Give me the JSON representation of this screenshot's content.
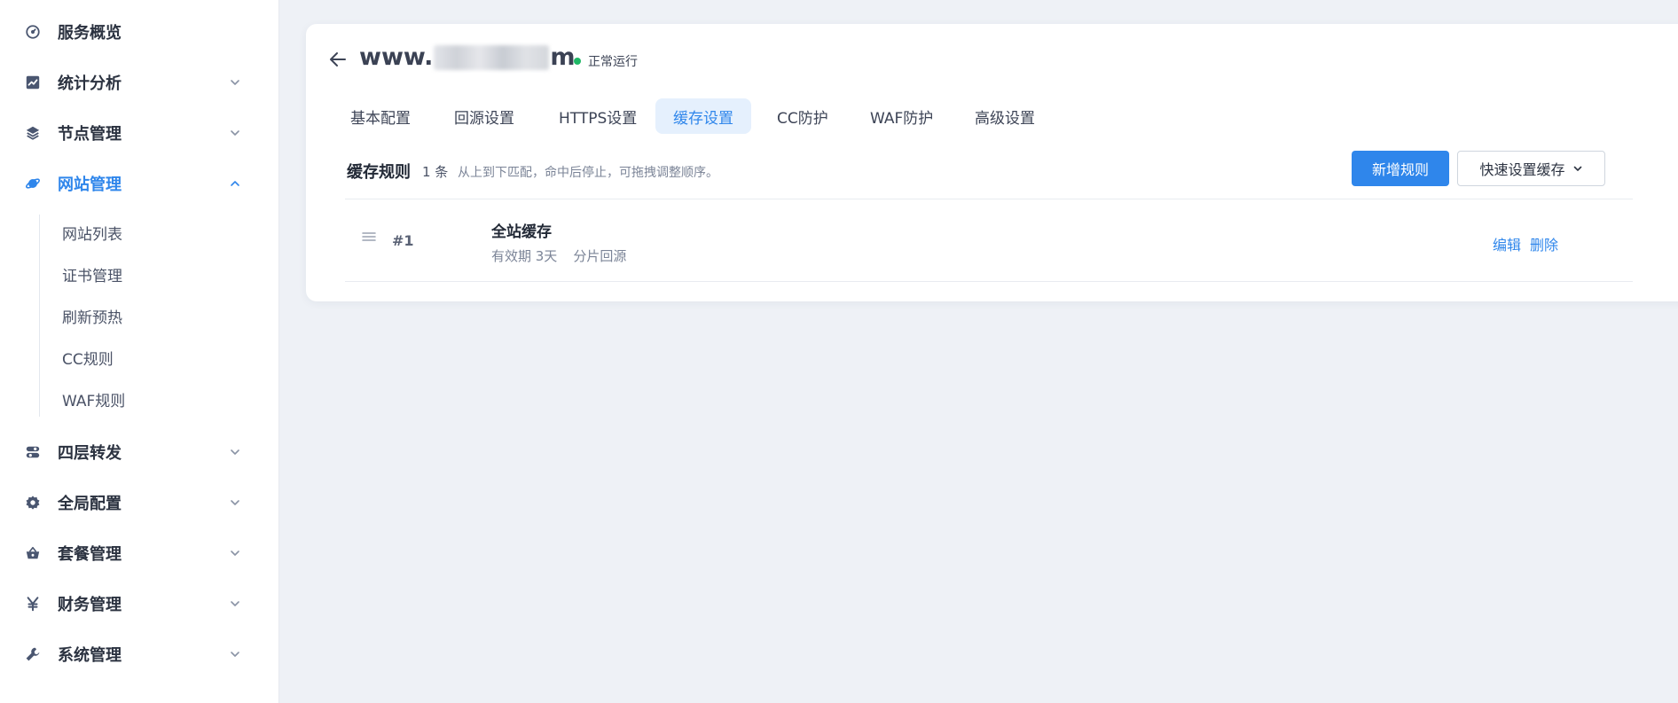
{
  "sidebar": {
    "items": [
      {
        "label": "服务概览",
        "icon": "dashboard-gauge-icon",
        "expandable": false
      },
      {
        "label": "统计分析",
        "icon": "chart-line-icon",
        "expandable": true
      },
      {
        "label": "节点管理",
        "icon": "layers-icon",
        "expandable": true
      },
      {
        "label": "网站管理",
        "icon": "planet-icon",
        "expandable": true,
        "active": true
      },
      {
        "label": "四层转发",
        "icon": "toggle-icon",
        "expandable": true
      },
      {
        "label": "全局配置",
        "icon": "gear-icon",
        "expandable": true
      },
      {
        "label": "套餐管理",
        "icon": "basket-icon",
        "expandable": true
      },
      {
        "label": "财务管理",
        "icon": "yen-icon",
        "expandable": true
      },
      {
        "label": "系统管理",
        "icon": "wrench-icon",
        "expandable": true
      }
    ],
    "submenu": [
      "网站列表",
      "证书管理",
      "刷新预热",
      "CC规则",
      "WAF规则"
    ]
  },
  "site": {
    "domain_prefix": "www.",
    "domain_suffix": "m",
    "status": "正常运行",
    "status_color": "#1fb866"
  },
  "tabs": [
    {
      "label": "基本配置"
    },
    {
      "label": "回源设置"
    },
    {
      "label": "HTTPS设置"
    },
    {
      "label": "缓存设置",
      "active": true
    },
    {
      "label": "CC防护"
    },
    {
      "label": "WAF防护"
    },
    {
      "label": "高级设置"
    }
  ],
  "cache": {
    "title": "缓存规则",
    "count": "1 条",
    "description": "从上到下匹配，命中后停止，可拖拽调整顺序。",
    "add_button": "新增规则",
    "quick_button": "快速设置缓存",
    "rules": [
      {
        "index": "#1",
        "name": "全站缓存",
        "ttl": "有效期 3天",
        "mode": "分片回源",
        "edit": "编辑",
        "delete": "删除"
      }
    ]
  },
  "colors": {
    "accent": "#2f86eb",
    "tab_active_bg": "#e5f0fd",
    "page_bg": "#eef1f6"
  }
}
